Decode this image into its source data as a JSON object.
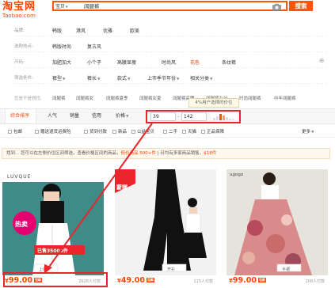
{
  "header": {
    "logo": {
      "brand": "淘宝网",
      "domain": "Taobao.com"
    },
    "hint": "PERCEBORO大于1千",
    "search_type": "宝贝",
    "search_value": "阔腿裤",
    "search_button": "搜索"
  },
  "filters": [
    {
      "label": "品牌:",
      "options": [
        "韩版",
        "港风",
        "优雅",
        "欧美"
      ]
    },
    {
      "label": "选购热点:",
      "options": [
        "韩版时尚",
        "复古风"
      ]
    },
    {
      "label": "尺码:",
      "options": [
        "加肥加大",
        "小个子",
        "高腰显瘦",
        "时尚风",
        "花色",
        "条纹裤"
      ]
    },
    {
      "label": "筛选条件:",
      "options": [
        "裤型",
        "裤长",
        "款式",
        "上市季节年份",
        "相关分类"
      ]
    }
  ],
  "related": {
    "label": "您是不是想找:",
    "items": [
      "阔腿裤",
      "阔腿裤女",
      "阔腿裤夏季",
      "阔腿裤女夏",
      "阔腿裤高腰",
      "阔腿裤九分",
      "时尚阔腿裤",
      "中年阔腿裤"
    ]
  },
  "tooltip": "4%用户选择的价位",
  "sort": {
    "items": [
      "综合排序",
      "人气",
      "销量",
      "信用",
      "价格"
    ],
    "price_from": "39",
    "price_to": "142"
  },
  "checkboxes": {
    "items": [
      "包邮",
      "赠送退货运费险",
      "货到付款",
      "新品",
      "公益宝贝",
      "二手",
      "天猫",
      "正品保障"
    ],
    "more": "更多"
  },
  "notice": {
    "prefix": "找到...",
    "text": "您可以在左侧价位区间筛选，查看价格区间的商品，",
    "highlight": "低价商品 500+件",
    "separator": "|",
    "text2": "日均有多家商品销售，",
    "highlight2": "$18件"
  },
  "products": [
    {
      "price": "99.00",
      "currency": "¥",
      "badge": "包邮",
      "sales": "2628人付款",
      "tag": "上装",
      "brand": "LUVQUE",
      "sticker": "热卖",
      "sold_banner": "已售35000件"
    },
    {
      "price": "49.00",
      "currency": "¥",
      "badge": "包邮",
      "sales": "115人付款",
      "tag": "开衫",
      "brand": "蒙娜"
    },
    {
      "price": "99.00",
      "currency": "¥",
      "badge": "包邮",
      "sales": "108人付款",
      "tag": "半裙",
      "brand": "ugogo"
    }
  ],
  "colors": {
    "accent": "#ff4400",
    "highlight_box": "#e8262b"
  }
}
